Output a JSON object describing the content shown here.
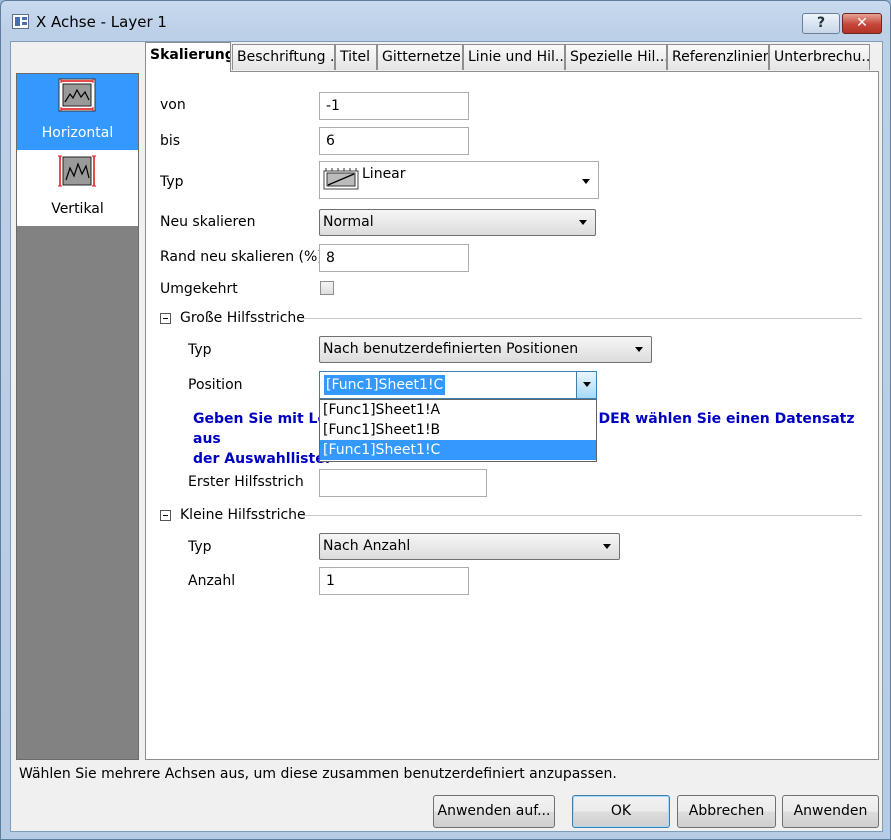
{
  "window": {
    "title": "X Achse - Layer 1",
    "help_label": "?",
    "close_label": "✕"
  },
  "nav": {
    "items": [
      {
        "label": "Horizontal",
        "selected": true
      },
      {
        "label": "Vertikal",
        "selected": false
      }
    ]
  },
  "tabs": [
    {
      "label": "Skalierung",
      "active": true
    },
    {
      "label": "Beschriftung ..."
    },
    {
      "label": "Titel"
    },
    {
      "label": "Gitternetze"
    },
    {
      "label": "Linie und Hil..."
    },
    {
      "label": "Spezielle Hil..."
    },
    {
      "label": "Referenzlinien"
    },
    {
      "label": "Unterbrechu..."
    }
  ],
  "form": {
    "von_label": "von",
    "von_value": "-1",
    "bis_label": "bis",
    "bis_value": "6",
    "typ_label": "Typ",
    "typ_value": "Linear",
    "neu_skalieren_label": "Neu skalieren",
    "neu_skalieren_value": "Normal",
    "rand_label": "Rand neu skalieren (%)",
    "rand_value": "8",
    "umgekehrt_label": "Umgekehrt",
    "umgekehrt_checked": false
  },
  "major_ticks": {
    "section_label": "Große Hilfsstriche",
    "typ_label": "Typ",
    "typ_value": "Nach benutzerdefinierten Positionen",
    "position_label": "Position",
    "position_value": "[Func1]Sheet1!C",
    "position_options": [
      "[Func1]Sheet1!A",
      "[Func1]Sheet1!B",
      "[Func1]Sheet1!C"
    ],
    "hint_line1_start": "Geben Sie mit Lee",
    "hint_line1_end": "DER wählen Sie einen Datensatz aus",
    "hint_line2": "der Auswahlliste.",
    "erster_label": "Erster Hilfsstrich",
    "erster_value": ""
  },
  "minor_ticks": {
    "section_label": "Kleine Hilfsstriche",
    "typ_label": "Typ",
    "typ_value": "Nach Anzahl",
    "anzahl_label": "Anzahl",
    "anzahl_value": "1"
  },
  "status": {
    "text": "Wählen Sie mehrere Achsen aus, um diese zusammen benutzerdefiniert anzupassen."
  },
  "buttons": {
    "apply_to": "Anwenden auf...",
    "ok": "OK",
    "cancel": "Abbrechen",
    "apply": "Anwenden"
  },
  "colors": {
    "selection": "#3399ff",
    "hint_text": "#0000c0",
    "nav_background": "#828282"
  }
}
